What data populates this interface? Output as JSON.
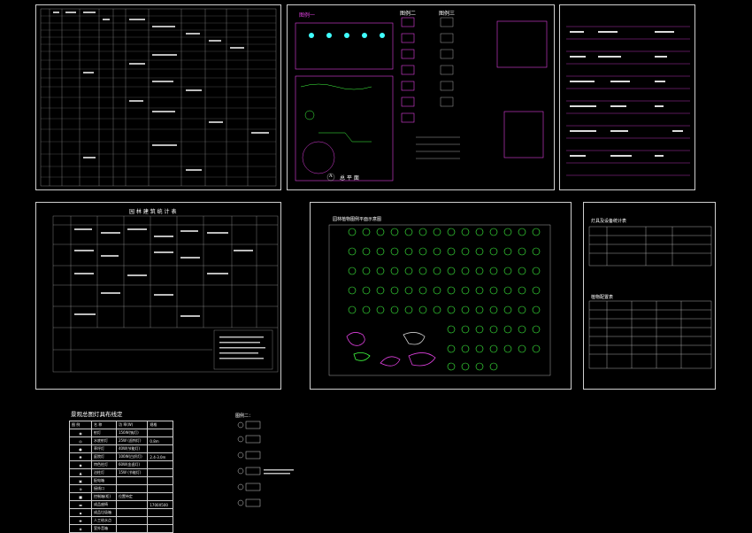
{
  "sheets": {
    "drawing_one_title": "图例一",
    "drawing_two_title": "图例二",
    "drawing_three_title": "图例三",
    "site_plan_label": "总 平 面",
    "site_plan_badge": "A",
    "facility_table_title": "园 林 建 筑 统 计 表",
    "plant_sheet_title": "园林植物图例平面示意图",
    "lighting_table_title": "灯具及设备统计表",
    "plant_list_title": "植物配置表",
    "legend_two_title": "图例二："
  },
  "lighting_legend": {
    "title": "景观总图灯具布线定",
    "headers": [
      "图 例",
      "名 称",
      "功 率(W)",
      "规格"
    ],
    "rows": [
      {
        "name": "射灯",
        "power": "150W(钠灯)",
        "spec": ""
      },
      {
        "name": "水底射灯",
        "power": "25W (卤钨灯)",
        "spec": "0.8m"
      },
      {
        "name": "草坪灯",
        "power": "40W(节能灯)",
        "spec": ""
      },
      {
        "name": "庭院灯",
        "power": "100W(白炽灯)",
        "spec": "2.4-3.0m"
      },
      {
        "name": "特色柱灯",
        "power": "60W(金卤灯)",
        "spec": ""
      },
      {
        "name": "泊柱灯",
        "power": "15W (节能灯)",
        "spec": ""
      },
      {
        "name": "配电箱",
        "power": "",
        "spec": ""
      },
      {
        "name": "接线口",
        "power": "",
        "spec": ""
      },
      {
        "name": "控制箱(柜)",
        "power": "位置待定",
        "spec": ""
      },
      {
        "name": "成品座椅",
        "power": "",
        "spec": "1700X500"
      },
      {
        "name": "成品垃圾箱",
        "power": "",
        "spec": ""
      },
      {
        "name": "人工给水点",
        "power": "",
        "spec": ""
      },
      {
        "name": "室外音箱",
        "power": "",
        "spec": ""
      }
    ]
  },
  "colors": {
    "background": "#000000",
    "frame": "#cfcfcf",
    "accent_magenta": "#e040e0",
    "accent_green": "#40ff40",
    "accent_cyan": "#40ffff"
  }
}
